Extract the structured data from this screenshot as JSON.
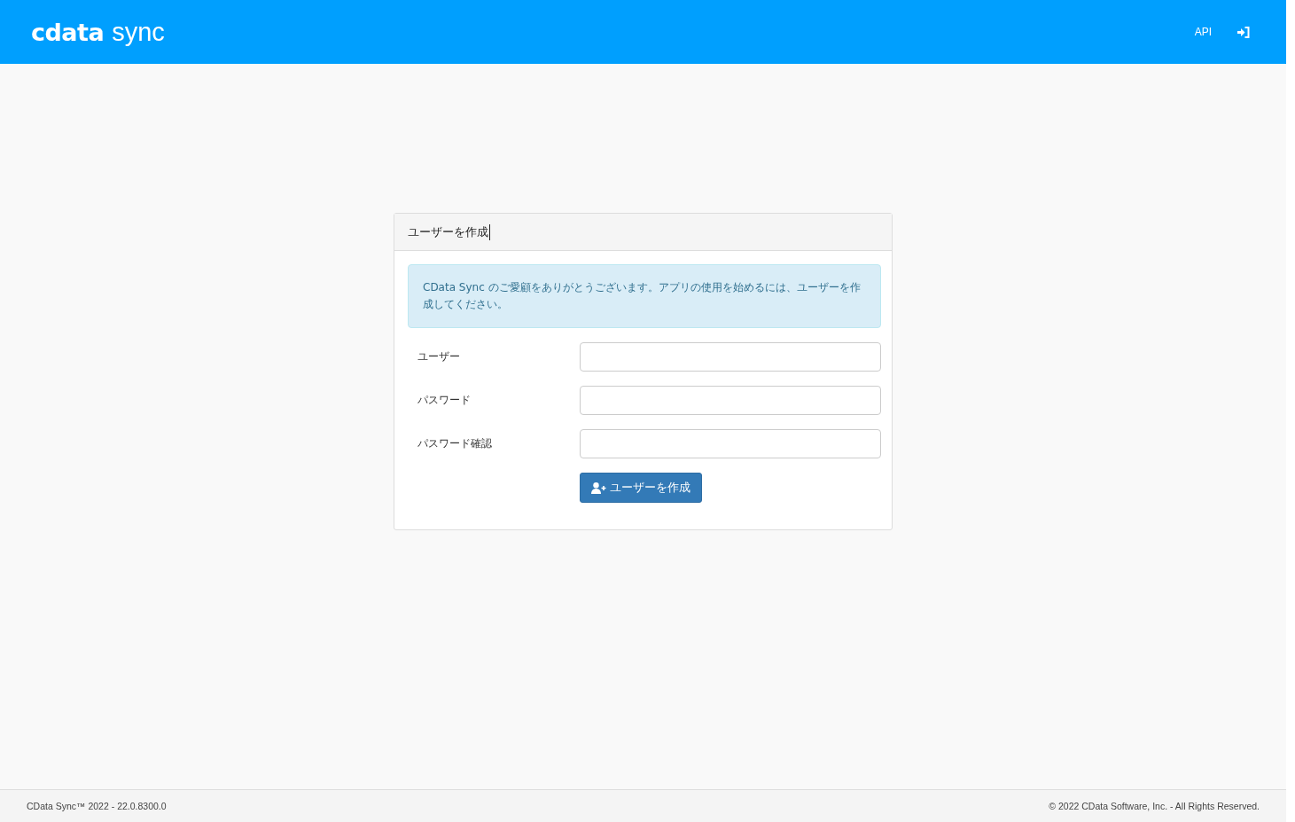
{
  "header": {
    "logo": {
      "brand": "cdata",
      "product": "sync"
    },
    "nav": [
      {
        "kind": "text",
        "label": "API"
      },
      {
        "kind": "icon"
      }
    ]
  },
  "panel": {
    "title": "ユーザーを作成",
    "alert": "CData Sync のご愛顧をありがとうございます。アプリの使用を始めるには、ユーザーを作成してください。",
    "fields": [
      {
        "label": "ユーザー"
      },
      {
        "label": "パスワード"
      },
      {
        "label": "パスワード確認"
      }
    ],
    "button": "ユーザーを作成"
  },
  "footer": {
    "left": "CData Sync™ 2022 - 22.0.8300.0",
    "right": "© 2022 CData Software, Inc. - All Rights Reserved."
  }
}
